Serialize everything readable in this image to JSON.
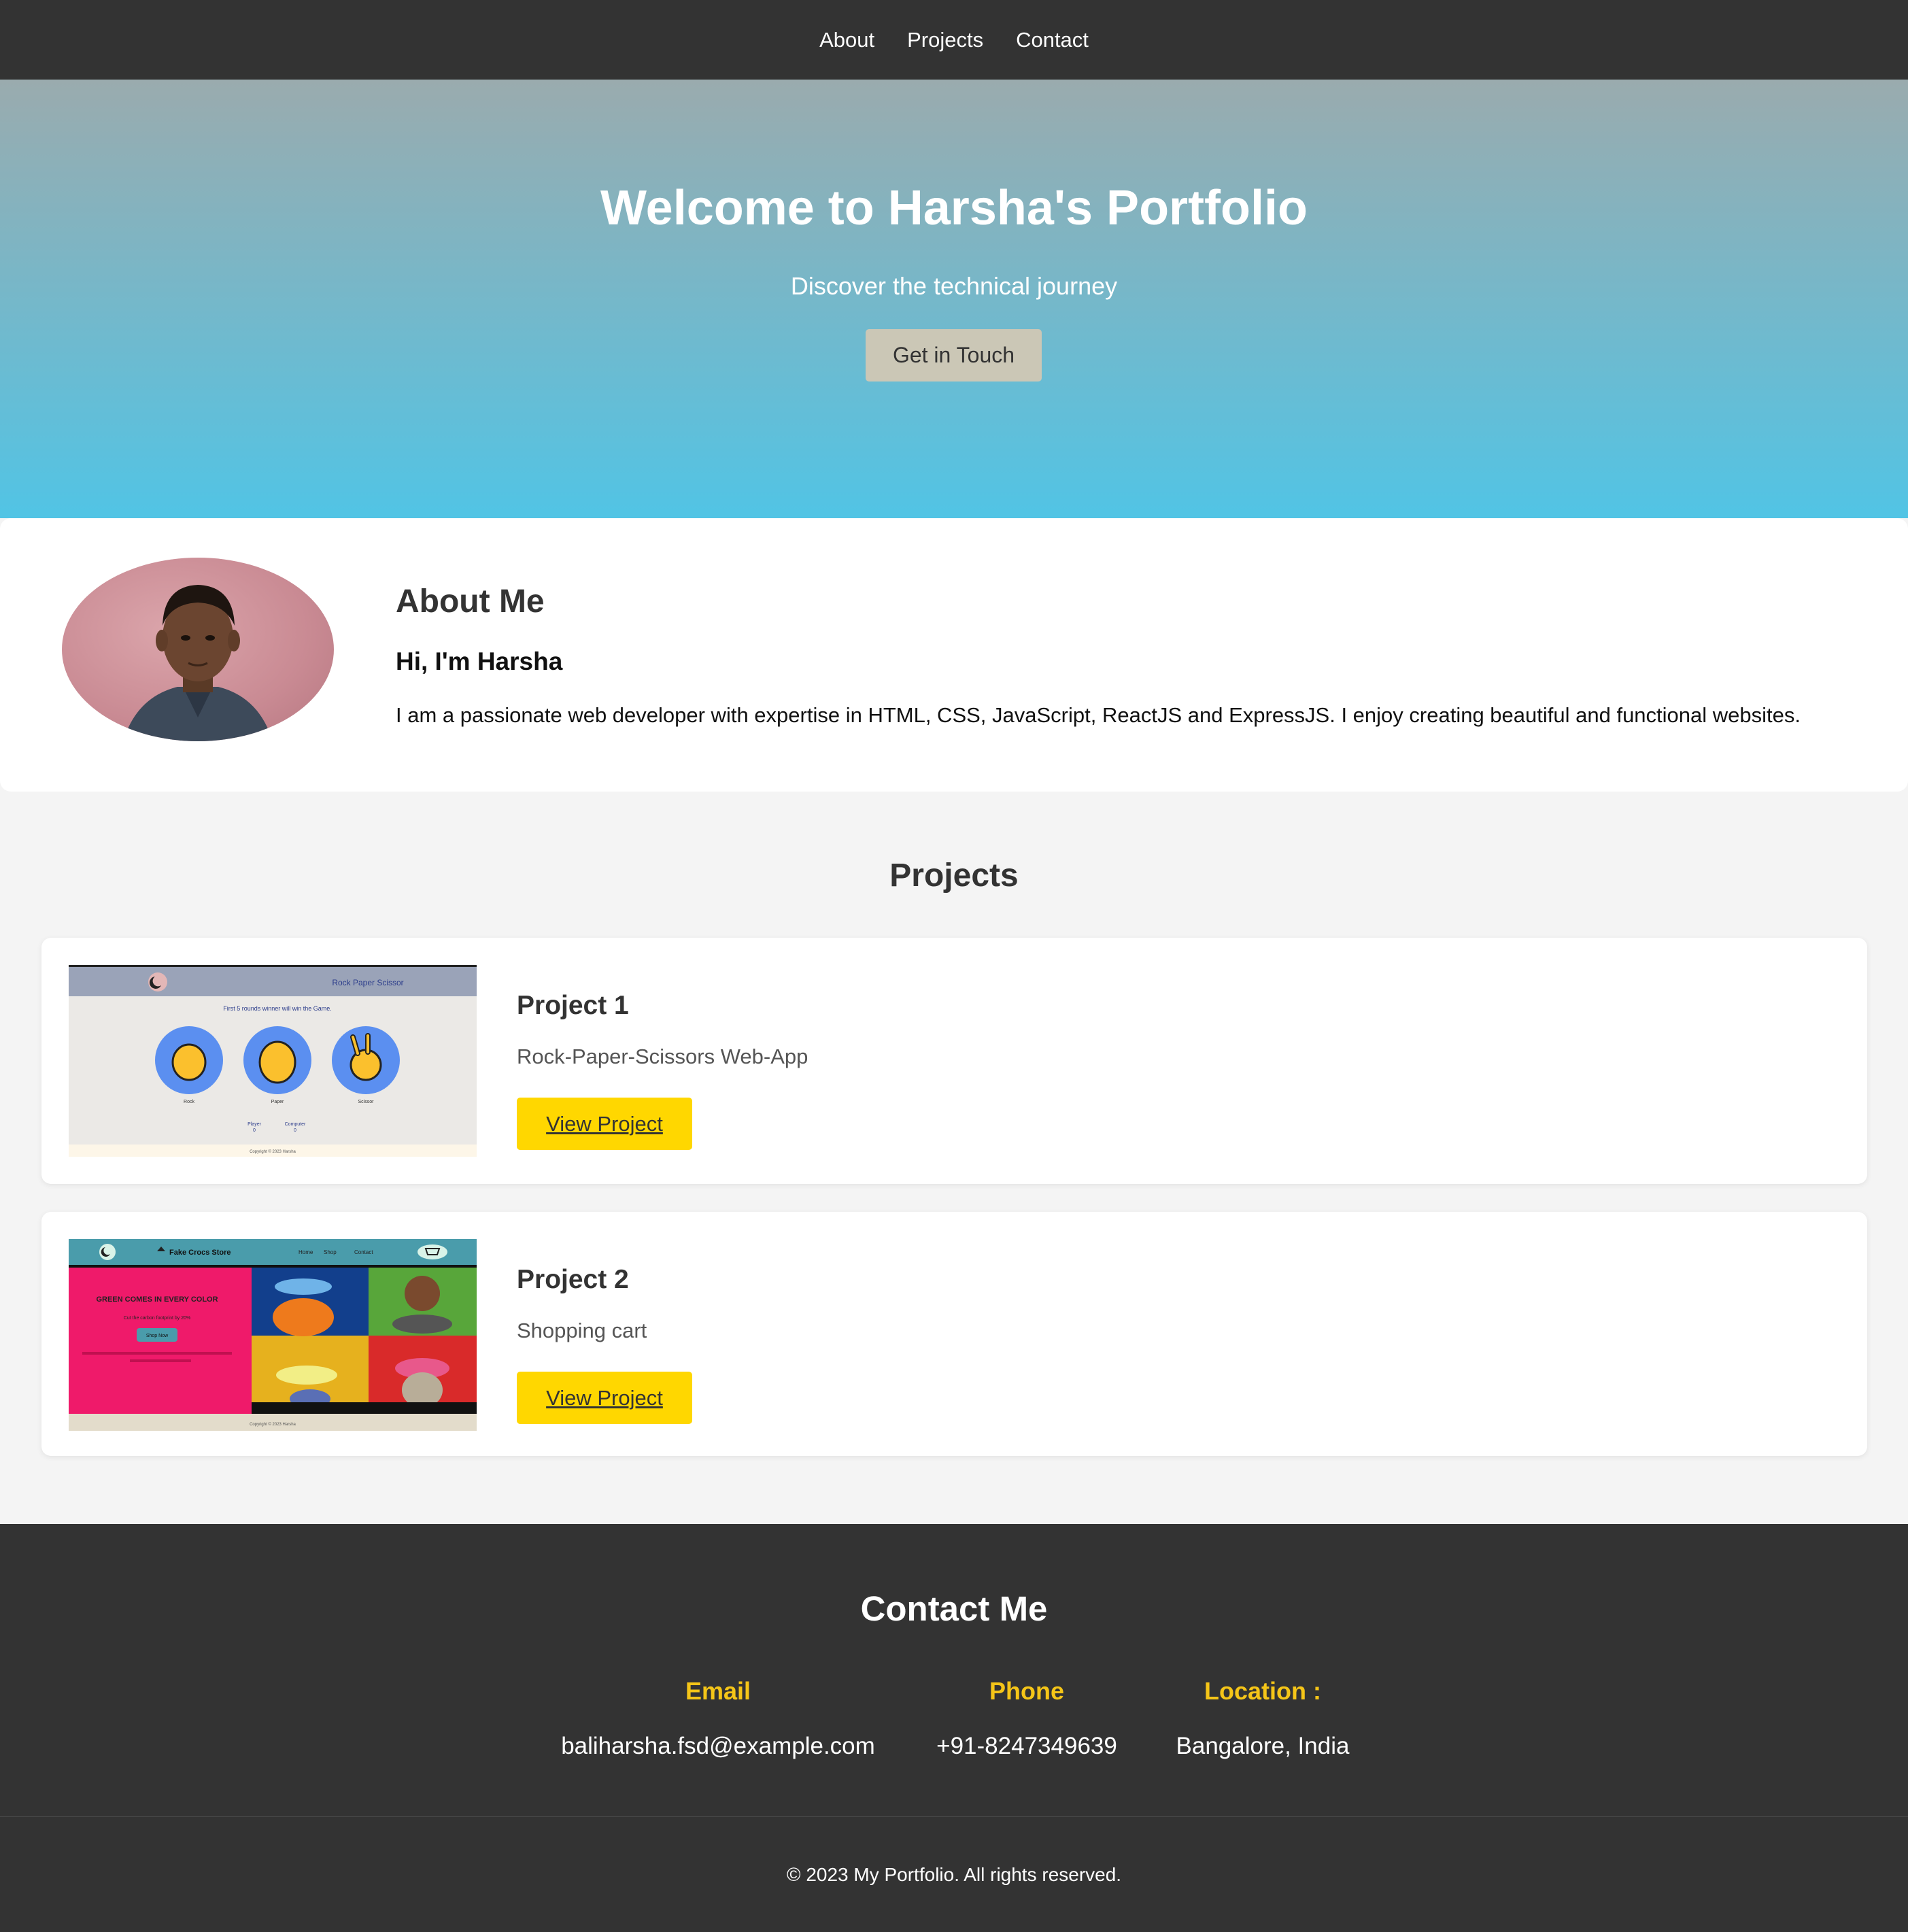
{
  "nav": {
    "items": [
      "About",
      "Projects",
      "Contact"
    ]
  },
  "hero": {
    "title": "Welcome to Harsha's Portfolio",
    "subtitle": "Discover the technical journey",
    "cta_label": "Get in Touch",
    "gradient_top": "#9aabae",
    "gradient_bottom": "#51c4e5"
  },
  "about": {
    "heading": "About Me",
    "greeting": "Hi, I'm Harsha",
    "bio": "I am a passionate web developer with expertise in HTML, CSS, JavaScript, ReactJS and ExpressJS. I enjoy creating beautiful and functional websites."
  },
  "projects": {
    "heading": "Projects",
    "items": [
      {
        "title": "Project 1",
        "description": "Rock-Paper-Scissors Web-App",
        "button": "View Project",
        "thumb": {
          "app_title": "Rock Paper Scissor",
          "instruction": "First 5 rounds winner will win the Game.",
          "choices": [
            "Rock",
            "Paper",
            "Scissor"
          ],
          "score_labels": [
            "Player",
            "Computer"
          ],
          "scores": [
            "0",
            "0"
          ],
          "footer": "Copyright © 2023 Harsha"
        }
      },
      {
        "title": "Project 2",
        "description": "Shopping cart",
        "button": "View Project",
        "thumb": {
          "store_name": "Fake Crocs Store",
          "nav": [
            "Home",
            "Shop",
            "Contact"
          ],
          "headline": "GREEN COMES IN EVERY COLOR",
          "tagline": "Cut the carbon footprint by 20%",
          "shop_button": "Shop Now",
          "footer": "Copyright © 2023 Harsha"
        }
      }
    ]
  },
  "contact": {
    "heading": "Contact Me",
    "email_label": "Email",
    "email": "baliharsha.fsd@example.com",
    "phone_label": "Phone",
    "phone": "+91-8247349639",
    "location_label": "Location :",
    "location": "Bangalore, India"
  },
  "footer": {
    "text": "© 2023 My Portfolio. All rights reserved."
  },
  "colors": {
    "nav_bg": "#333333",
    "accent_yellow": "#ffd700",
    "label_yellow": "#f5c518"
  }
}
